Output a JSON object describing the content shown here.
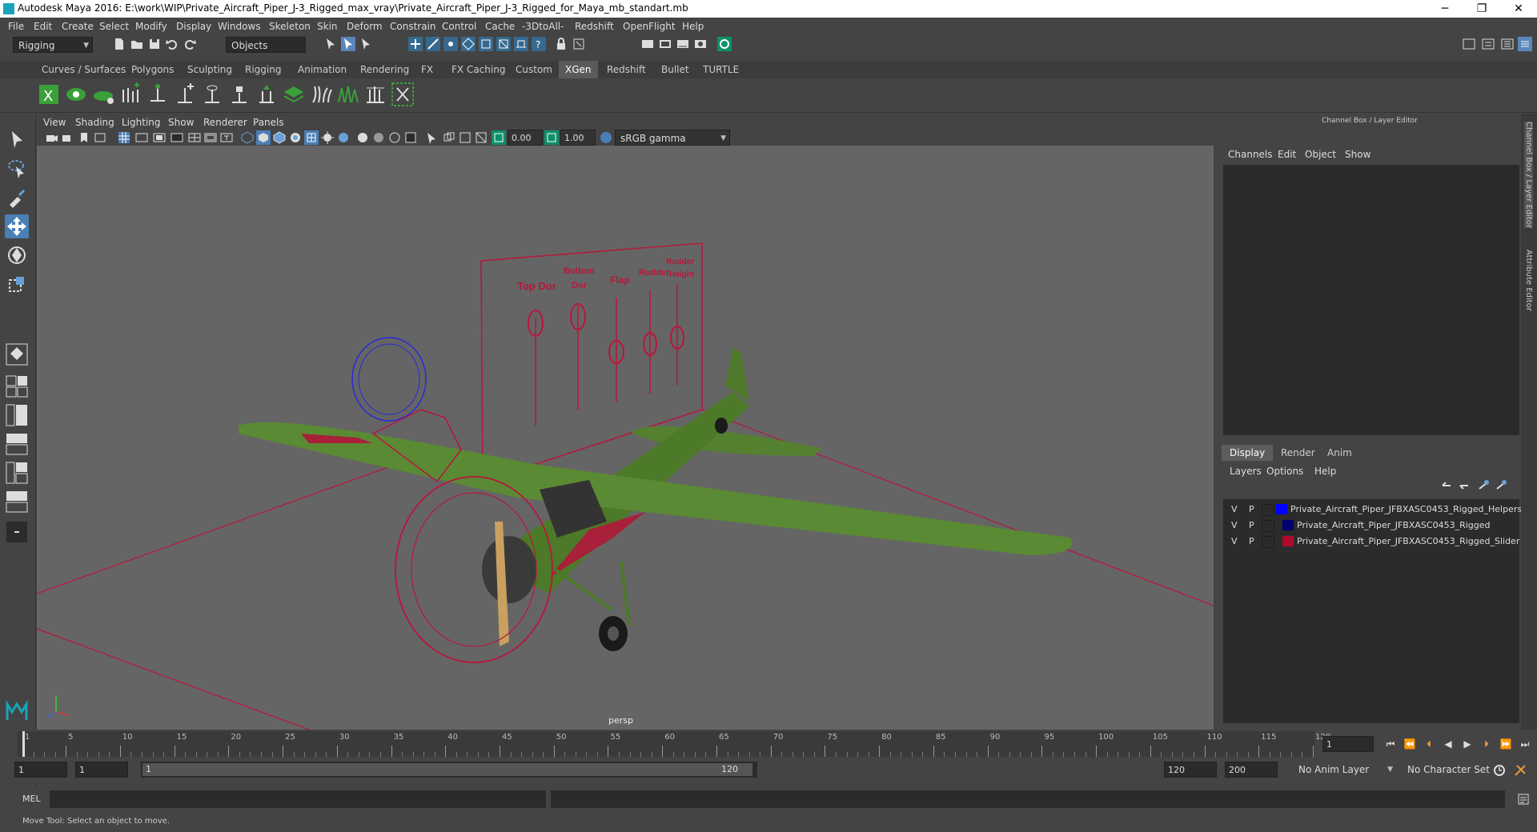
{
  "window": {
    "title": "Autodesk Maya 2016: E:\\work\\WIP\\Private_Aircraft_Piper_J-3_Rigged_max_vray\\Private_Aircraft_Piper_J-3_Rigged_for_Maya_mb_standart.mb",
    "minimize": "─",
    "maximize": "❐",
    "close": "✕"
  },
  "menus": [
    "File",
    "Edit",
    "Create",
    "Select",
    "Modify",
    "Display",
    "Windows",
    "Skeleton",
    "Skin",
    "Deform",
    "Constrain",
    "Control",
    "Cache",
    "-3DtoAll-",
    "Redshift",
    "OpenFlight",
    "Help"
  ],
  "statusline": {
    "mode": "Rigging",
    "selection_mode": "Objects"
  },
  "shelf_tabs": [
    "Curves / Surfaces",
    "Polygons",
    "Sculpting",
    "Rigging",
    "Animation",
    "Rendering",
    "FX",
    "FX Caching",
    "Custom",
    "XGen",
    "Redshift",
    "Bullet",
    "TURTLE"
  ],
  "shelf_active": "XGen",
  "viewport": {
    "menus": [
      "View",
      "Shading",
      "Lighting",
      "Show",
      "Renderer",
      "Panels"
    ],
    "exposure": "0.00",
    "gamma": "1.00",
    "color_space": "sRGB gamma",
    "camera_label": "persp",
    "slider_labels": [
      "Top Dor",
      "Bottom\nDor",
      "Flap",
      "Rudder",
      "Rudder\nHeight"
    ]
  },
  "right_panel": {
    "header": "Channel Box / Layer Editor",
    "menus": [
      "Channels",
      "Edit",
      "Object",
      "Show"
    ],
    "tabs": [
      "Display",
      "Render",
      "Anim"
    ],
    "active_tab": "Display",
    "layer_menus": [
      "Layers",
      "Options",
      "Help"
    ],
    "layers": [
      {
        "v": "V",
        "p": "P",
        "name": "Private_Aircraft_Piper_JFBXASC0453_Rigged_Helpers",
        "color": "#0000ff"
      },
      {
        "v": "V",
        "p": "P",
        "name": "Private_Aircraft_Piper_JFBXASC0453_Rigged",
        "color": "#00006e"
      },
      {
        "v": "V",
        "p": "P",
        "name": "Private_Aircraft_Piper_JFBXASC0453_Rigged_Slider",
        "color": "#b00a2a"
      }
    ],
    "side_tabs": [
      "Channel Box / Layer Editor",
      "Attribute Editor"
    ]
  },
  "timeline": {
    "ticks": [
      "1",
      "5",
      "10",
      "15",
      "20",
      "25",
      "30",
      "35",
      "40",
      "45",
      "50",
      "55",
      "60",
      "65",
      "70",
      "75",
      "80",
      "85",
      "90",
      "95",
      "100",
      "105",
      "110",
      "115",
      "120"
    ],
    "current_frame": "1"
  },
  "range": {
    "start": "1",
    "playback_start": "1",
    "slider_start": "1",
    "slider_end": "120",
    "playback_end": "120",
    "end": "200",
    "anim_layer": "No Anim Layer",
    "character_set": "No Character Set"
  },
  "command": {
    "lang": "MEL"
  },
  "help_line": "Move Tool: Select an object to move."
}
